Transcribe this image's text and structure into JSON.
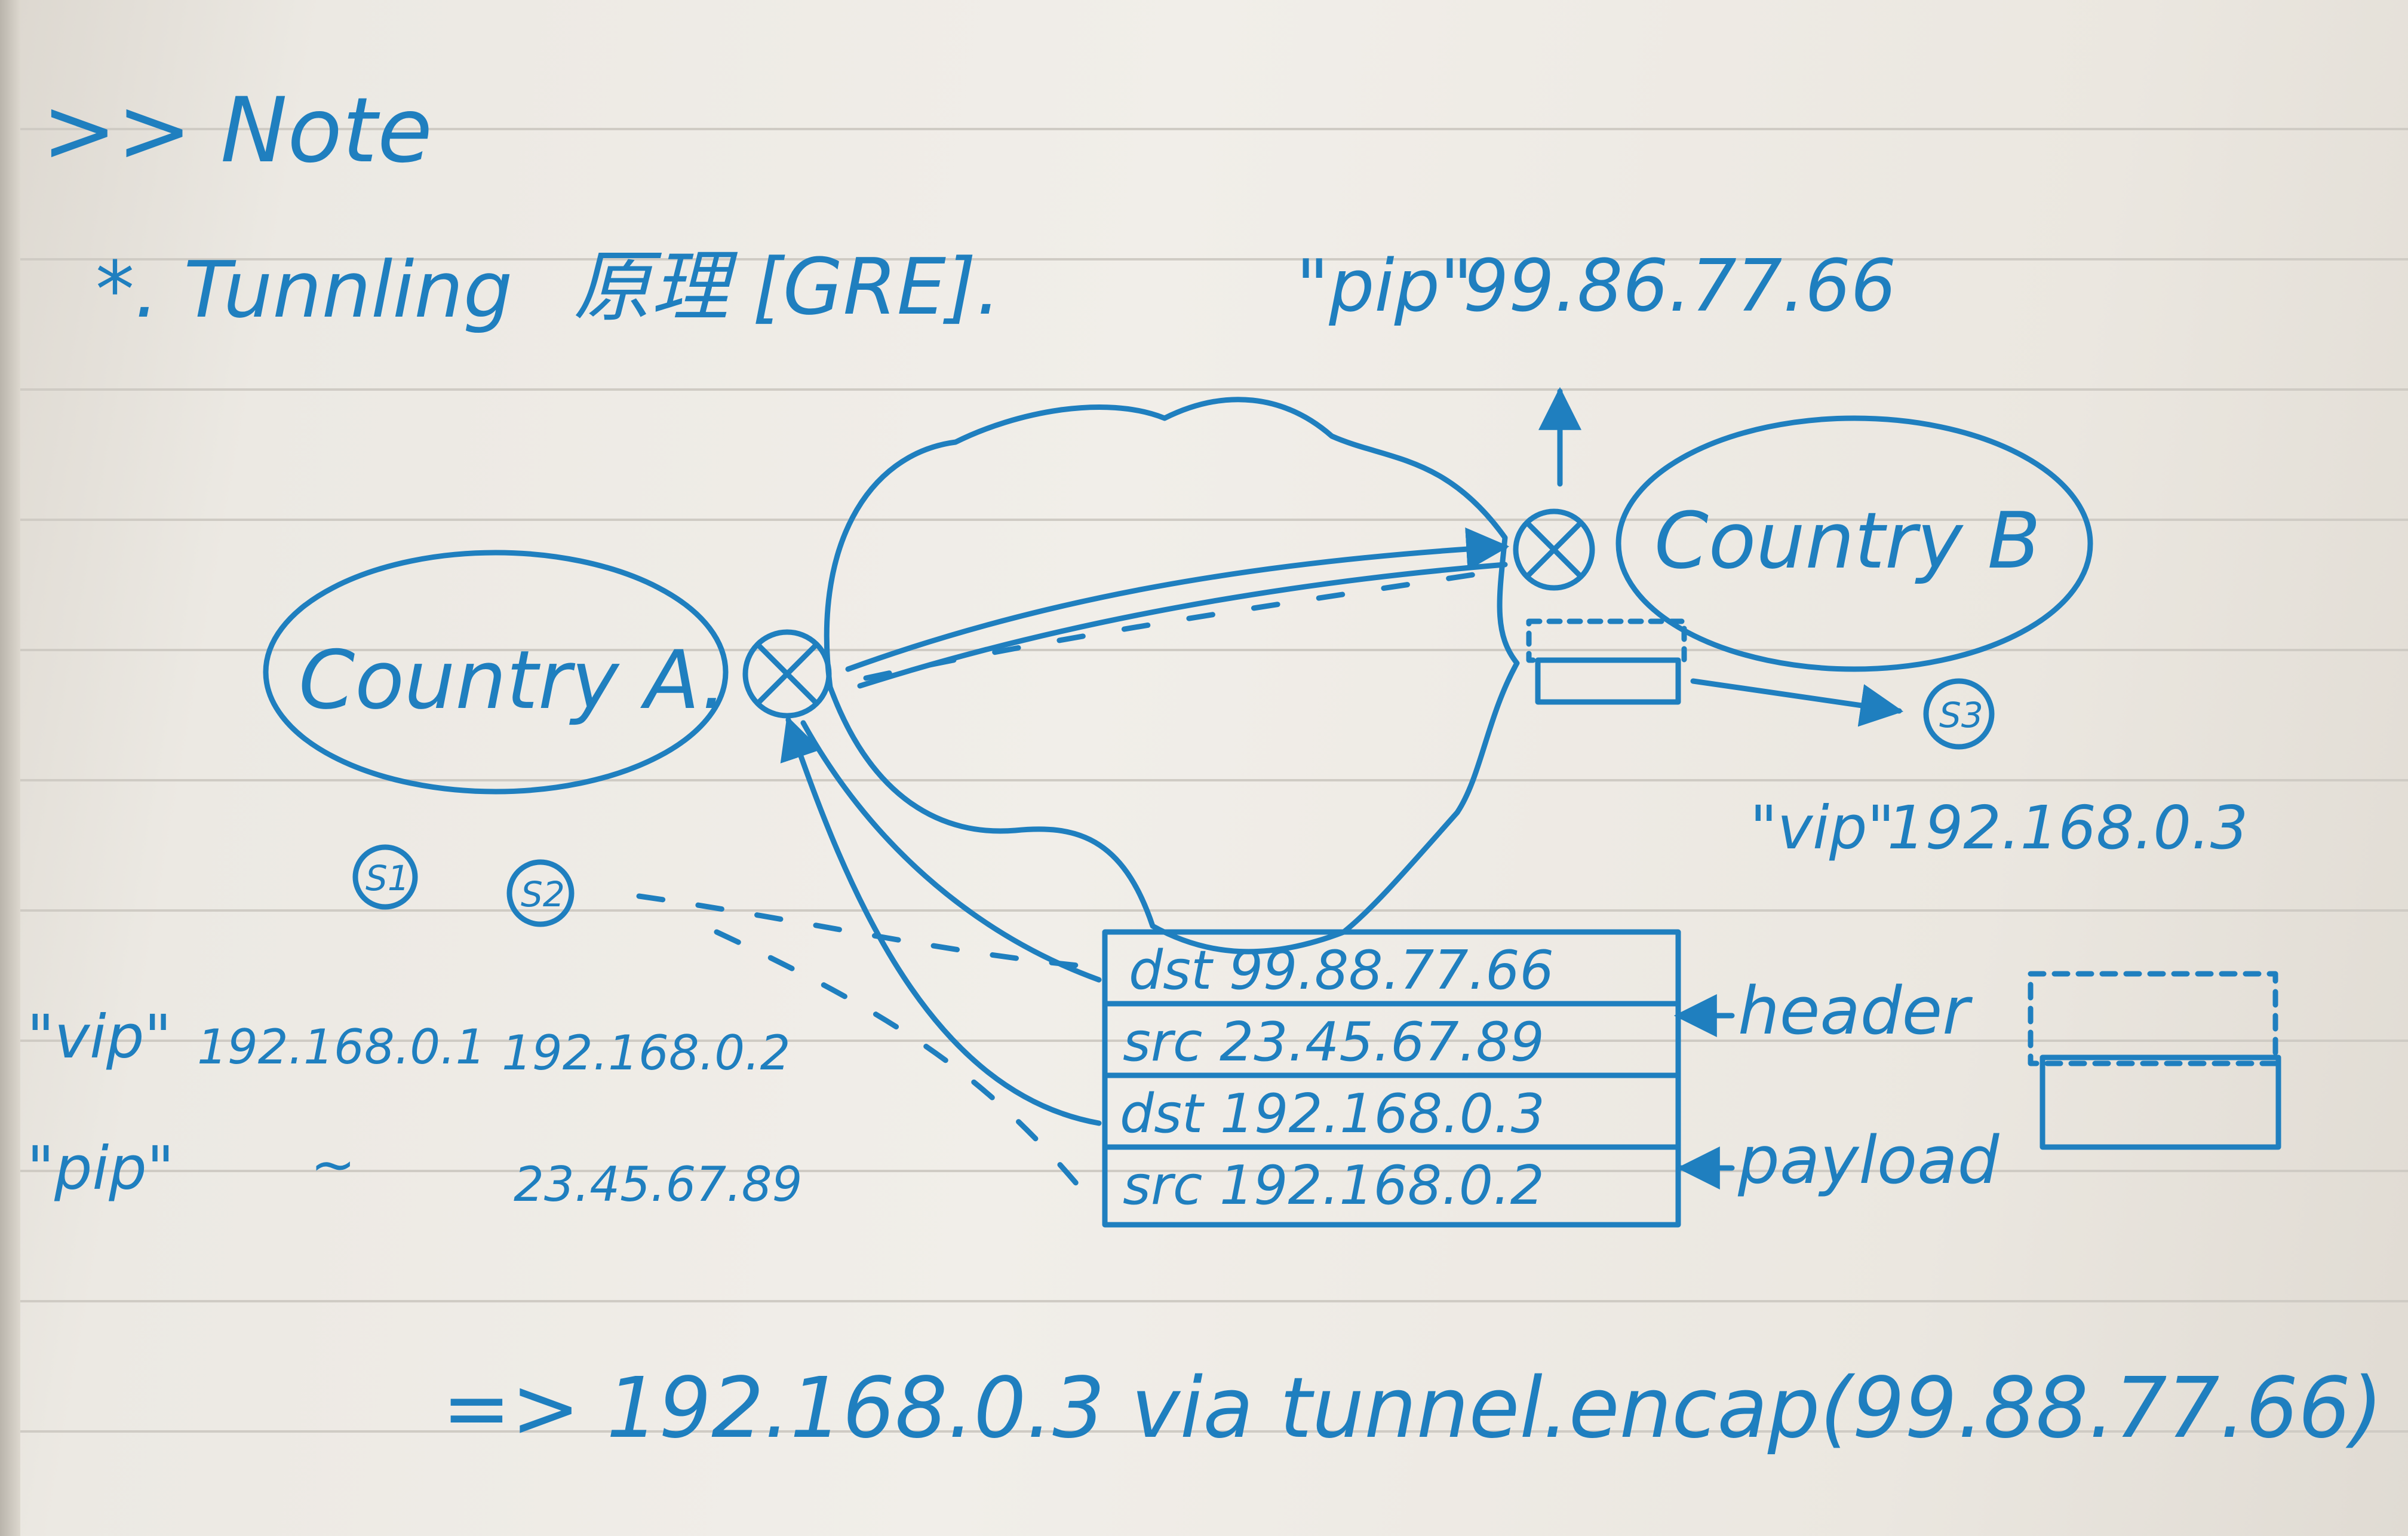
{
  "note_heading": ">> Note",
  "title": {
    "prefix": "*. Tunnling",
    "cn": "原理",
    "tag": "[GRE]."
  },
  "pip_b": {
    "label": "\"pip\"",
    "ip": "99.86.77.66"
  },
  "country_a": "Country A.",
  "country_b": "Country B",
  "hosts": {
    "s1": "S1",
    "s2": "S2",
    "s3": "S3"
  },
  "vip_b": {
    "label": "\"vip\"",
    "ip": "192.168.0.3"
  },
  "table_a": {
    "vip_label": "\"vip\"",
    "pip_label": "\"pip\"",
    "s1_vip": "192.168.0.1",
    "s2_vip": "192.168.0.2",
    "s1_pip": "~",
    "s2_pip": "23.45.67.89"
  },
  "packet": {
    "header_dst": "dst 99.88.77.66",
    "header_src": "src 23.45.67.89",
    "payload_dst": "dst 192.168.0.3",
    "payload_src": "src 192.168.0.2"
  },
  "labels": {
    "header": "header",
    "payload": "payload"
  },
  "route": "=> 192.168.0.3 via tunnel.encap(99.88.77.66)",
  "ink_color": "#1f7fbf",
  "paper_color": "#ece9e3"
}
